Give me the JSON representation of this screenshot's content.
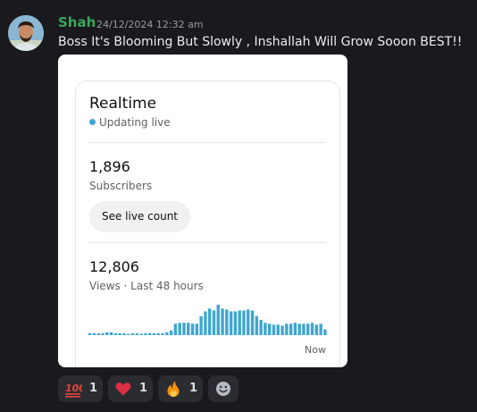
{
  "message": {
    "username": "Shah",
    "timestamp": "24/12/2024 12:32 am",
    "text": "Boss It's Blooming But Slowly , Inshallah Will Grow Sooon BEST!!",
    "avatar_icon": "user-avatar-icon"
  },
  "attachment": {
    "realtime_title": "Realtime",
    "live_status": "Updating live",
    "subscribers_value": "1,896",
    "subscribers_label": "Subscribers",
    "live_count_button": "See live count",
    "views_value": "12,806",
    "views_label": "Views · Last 48 hours",
    "chart_end_label": "Now",
    "accent_color": "#3ea6d0"
  },
  "chart_data": {
    "type": "bar",
    "title": "",
    "xlabel": "",
    "ylabel": "",
    "series_color": "#3ea6d0",
    "values": [
      2,
      2,
      2,
      2,
      3,
      3,
      2,
      2,
      2,
      1,
      2,
      2,
      1,
      2,
      2,
      2,
      2,
      2,
      3,
      5,
      12,
      13,
      13,
      13,
      12,
      12,
      20,
      25,
      28,
      26,
      32,
      28,
      27,
      25,
      25,
      26,
      26,
      27,
      26,
      20,
      16,
      13,
      12,
      11,
      11,
      10,
      12,
      12,
      13,
      12,
      12,
      12,
      13,
      11,
      12,
      6
    ]
  },
  "reactions": [
    {
      "emoji": "hundred-points-icon",
      "count": "1"
    },
    {
      "emoji": "red-heart-icon",
      "count": "1"
    },
    {
      "emoji": "fire-icon",
      "count": "1"
    }
  ],
  "add_reaction_icon": "add-reaction-smiley-icon"
}
